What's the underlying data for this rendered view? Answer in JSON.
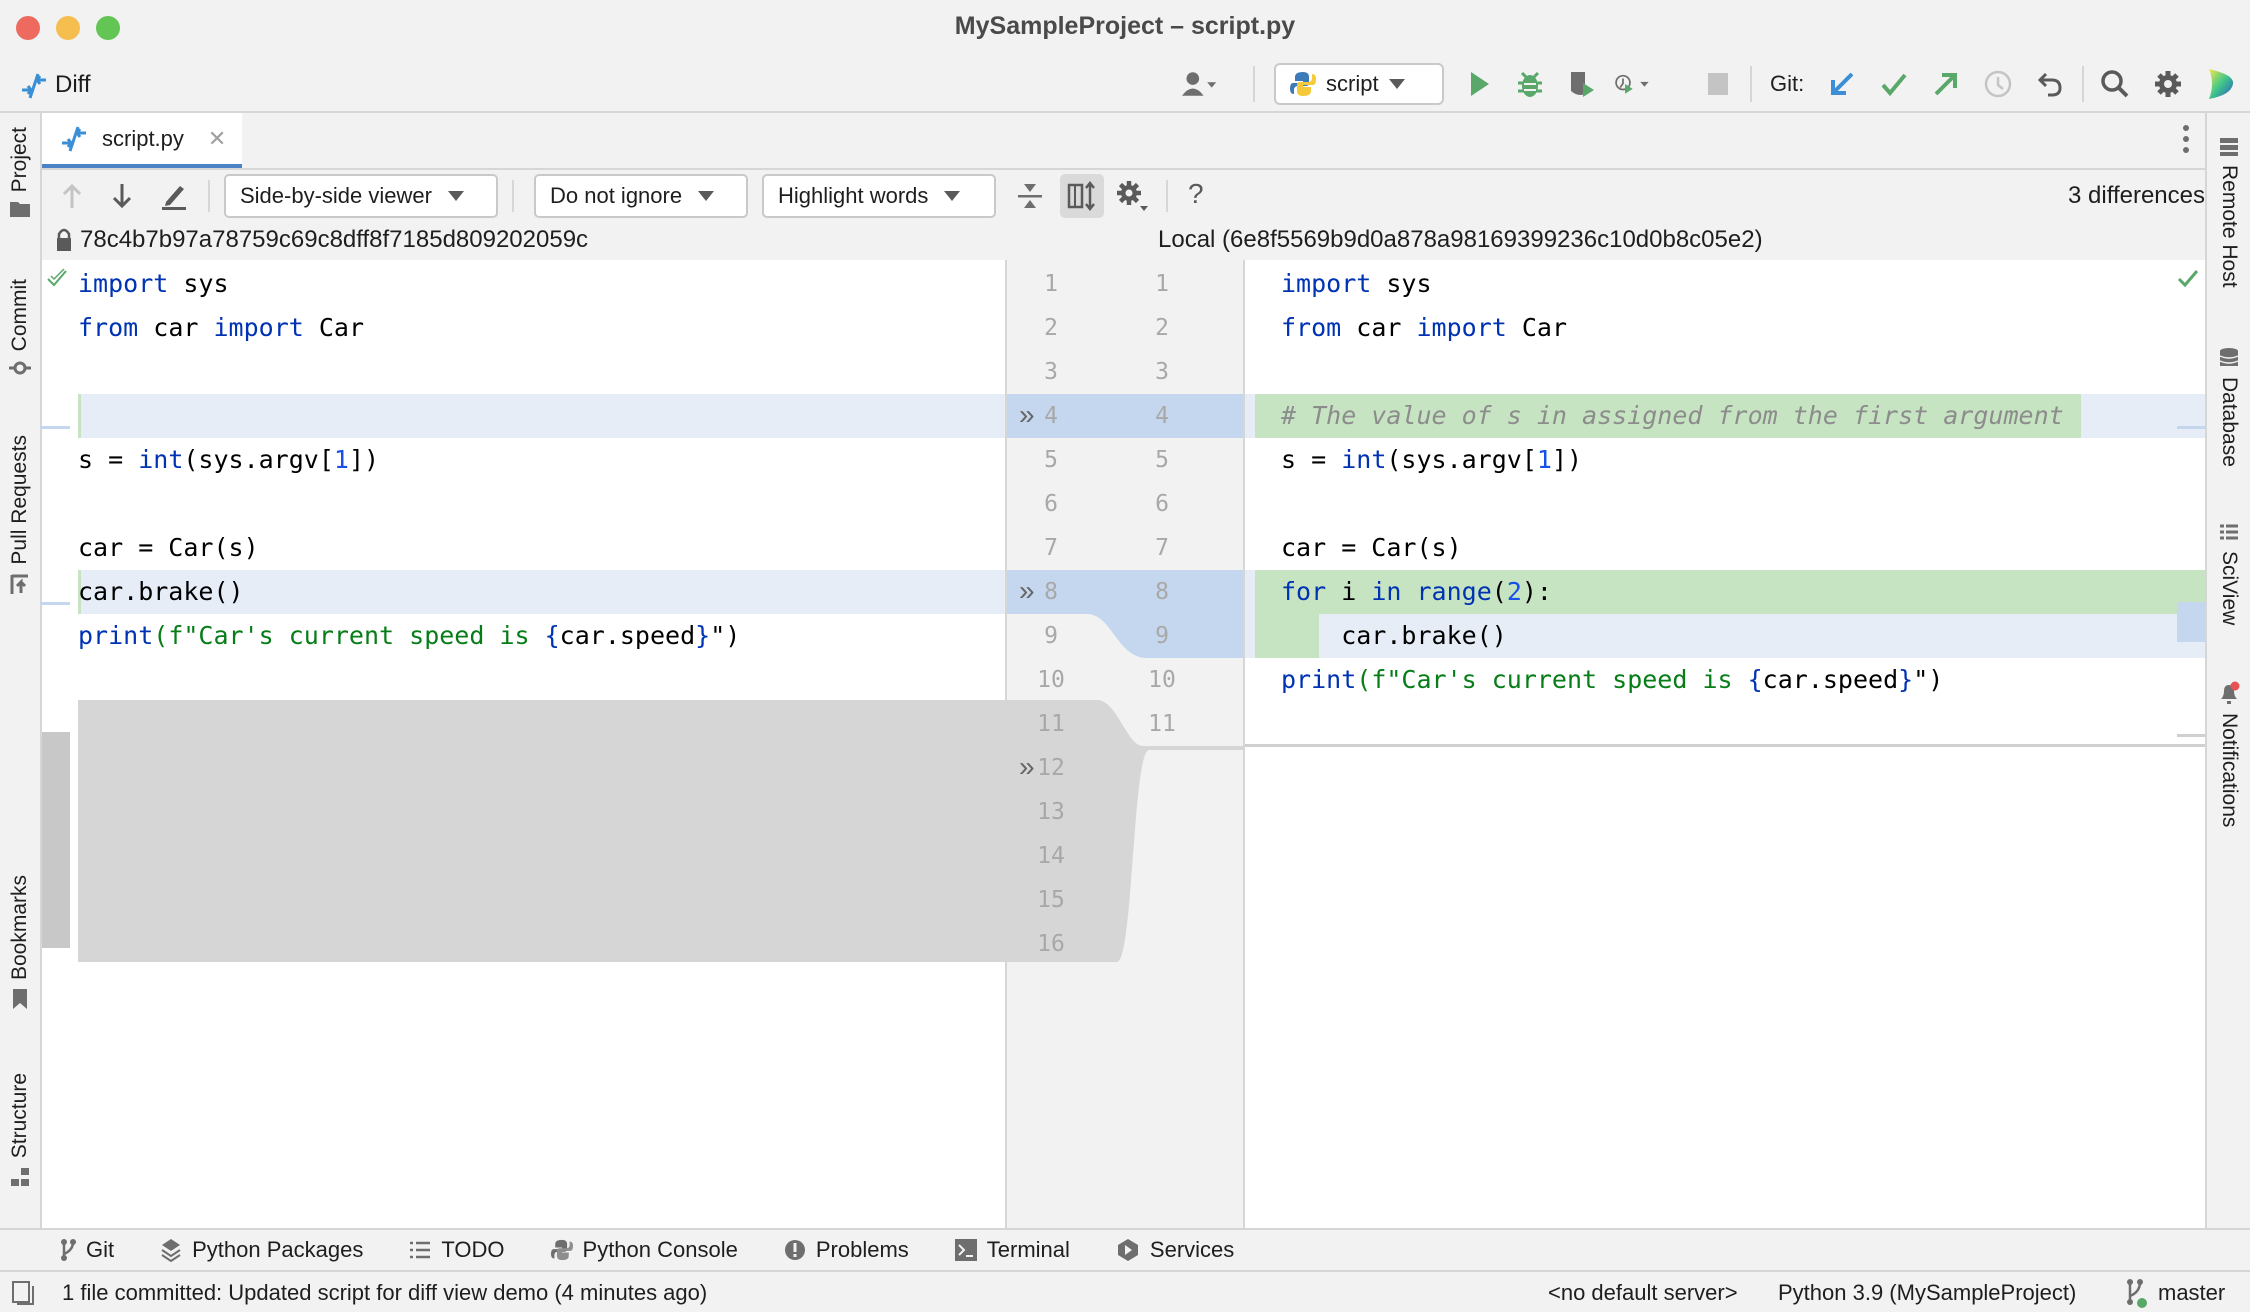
{
  "window": {
    "title": "MySampleProject – script.py",
    "traffic_lights": {
      "close": "#ee6a5f",
      "minimize": "#f5be4f",
      "zoom": "#62c554"
    }
  },
  "toolbar": {
    "diff_label": "Diff",
    "run_config": "script",
    "git_label": "Git:",
    "icons": [
      "account-icon",
      "python-icon",
      "run-icon",
      "debug-icon",
      "coverage-icon",
      "profile-icon",
      "stop-icon",
      "git-update-icon",
      "git-commit-icon",
      "git-push-icon",
      "git-history-icon",
      "git-rollback-icon",
      "search-icon",
      "settings-icon",
      "jetbrains-icon"
    ]
  },
  "tab": {
    "label": "script.py"
  },
  "diff_toolbar": {
    "viewer": "Side-by-side viewer",
    "ignore": "Do not ignore",
    "highlight": "Highlight words",
    "help": "?",
    "count": "3 differences"
  },
  "left_stripe": [
    "Project",
    "Commit",
    "Pull Requests",
    "Bookmarks",
    "Structure"
  ],
  "right_stripe": [
    "Remote Host",
    "Database",
    "SciView",
    "Notifications"
  ],
  "diff": {
    "left_header": "78c4b7b97a78759c69c8dff8f7185d809202059c",
    "right_header": "Local (6e8f5569b9d0a878a98169399236c10d0b8c05e2)",
    "left_line_numbers": [
      "1",
      "2",
      "3",
      "4",
      "5",
      "6",
      "7",
      "8",
      "9",
      "10",
      "11",
      "12",
      "13",
      "14",
      "15",
      "16"
    ],
    "right_line_numbers": [
      "1",
      "2",
      "3",
      "4",
      "5",
      "6",
      "7",
      "8",
      "9",
      "10",
      "11"
    ],
    "left_lines": [
      {
        "n": 1,
        "tokens": [
          {
            "t": "import",
            "c": "kw"
          },
          {
            "t": " sys"
          }
        ]
      },
      {
        "n": 2,
        "tokens": [
          {
            "t": "from",
            "c": "kw"
          },
          {
            "t": " car "
          },
          {
            "t": "import",
            "c": "kw"
          },
          {
            "t": " Car"
          }
        ]
      },
      {
        "n": 3,
        "tokens": []
      },
      {
        "n": 4,
        "tokens": []
      },
      {
        "n": 5,
        "tokens": [
          {
            "t": "s = "
          },
          {
            "t": "int",
            "c": "kw"
          },
          {
            "t": "(sys.argv["
          },
          {
            "t": "1",
            "c": "num"
          },
          {
            "t": "])"
          }
        ]
      },
      {
        "n": 6,
        "tokens": []
      },
      {
        "n": 7,
        "tokens": [
          {
            "t": "car = Car(s)"
          }
        ]
      },
      {
        "n": 8,
        "tokens": [
          {
            "t": "car.brake()"
          }
        ]
      },
      {
        "n": 9,
        "tokens": [
          {
            "t": "print",
            "c": "kw"
          },
          {
            "t": "(f\"Car's current speed is ",
            "c": "str"
          },
          {
            "t": "{",
            "c": "kw"
          },
          {
            "t": "car.speed"
          },
          {
            "t": "}",
            "c": "kw"
          },
          {
            "t": "\")"
          }
        ]
      }
    ],
    "right_lines": [
      {
        "n": 1,
        "tokens": [
          {
            "t": "import",
            "c": "kw"
          },
          {
            "t": " sys"
          }
        ]
      },
      {
        "n": 2,
        "tokens": [
          {
            "t": "from",
            "c": "kw"
          },
          {
            "t": " car "
          },
          {
            "t": "import",
            "c": "kw"
          },
          {
            "t": " Car"
          }
        ]
      },
      {
        "n": 3,
        "tokens": []
      },
      {
        "n": 4,
        "tokens": [
          {
            "t": "# The value of s in assigned from the first argument",
            "c": "cmt"
          }
        ]
      },
      {
        "n": 5,
        "tokens": [
          {
            "t": "s = "
          },
          {
            "t": "int",
            "c": "kw"
          },
          {
            "t": "(sys.argv["
          },
          {
            "t": "1",
            "c": "num"
          },
          {
            "t": "])"
          }
        ]
      },
      {
        "n": 6,
        "tokens": []
      },
      {
        "n": 7,
        "tokens": [
          {
            "t": "car = Car(s)"
          }
        ]
      },
      {
        "n": 8,
        "tokens": [
          {
            "t": "for",
            "c": "kw"
          },
          {
            "t": " i "
          },
          {
            "t": "in",
            "c": "kw"
          },
          {
            "t": " "
          },
          {
            "t": "range",
            "c": "kw"
          },
          {
            "t": "("
          },
          {
            "t": "2",
            "c": "num"
          },
          {
            "t": "):"
          }
        ]
      },
      {
        "n": 9,
        "tokens": [
          {
            "t": "    car.brake()"
          }
        ]
      },
      {
        "n": 10,
        "tokens": [
          {
            "t": "print",
            "c": "kw"
          },
          {
            "t": "(f\"Car's current speed is ",
            "c": "str"
          },
          {
            "t": "{",
            "c": "kw"
          },
          {
            "t": "car.speed"
          },
          {
            "t": "}",
            "c": "kw"
          },
          {
            "t": "\")"
          }
        ]
      },
      {
        "n": 11,
        "tokens": []
      }
    ],
    "change_markers_left_lines": [
      "4",
      "8",
      "11"
    ],
    "colors": {
      "modified": "#c5d7ee",
      "modified_light": "#e6edf7",
      "inserted": "#c6e4c2",
      "deleted": "#d6d6d6"
    }
  },
  "tool_windows": [
    {
      "label": "Git",
      "icon": "git-branch-icon"
    },
    {
      "label": "Python Packages",
      "icon": "packages-icon"
    },
    {
      "label": "TODO",
      "icon": "list-icon"
    },
    {
      "label": "Python Console",
      "icon": "python-console-icon"
    },
    {
      "label": "Problems",
      "icon": "problems-icon"
    },
    {
      "label": "Terminal",
      "icon": "terminal-icon"
    },
    {
      "label": "Services",
      "icon": "services-icon"
    }
  ],
  "status_bar": {
    "message": "1 file committed: Updated script for diff view demo (4 minutes ago)",
    "server": "<no default server>",
    "interpreter": "Python 3.9 (MySampleProject)",
    "branch": "master"
  }
}
